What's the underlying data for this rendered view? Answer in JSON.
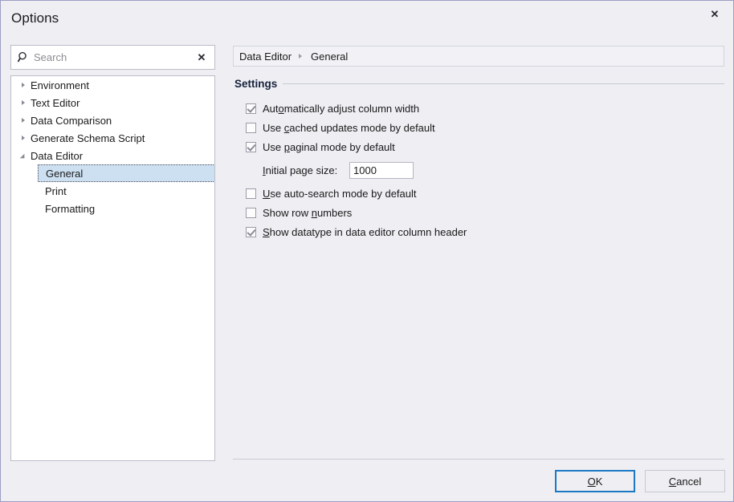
{
  "window": {
    "title": "Options",
    "close_icon": "close-icon",
    "close_label": "✕"
  },
  "search": {
    "placeholder": "Search",
    "value": "",
    "icon": "search-icon",
    "clear_label": "✕"
  },
  "tree": {
    "items": [
      {
        "label": "Environment",
        "level": 0,
        "state": "collapsed",
        "selected": false
      },
      {
        "label": "Text Editor",
        "level": 0,
        "state": "collapsed",
        "selected": false
      },
      {
        "label": "Data Comparison",
        "level": 0,
        "state": "collapsed",
        "selected": false
      },
      {
        "label": "Generate Schema Script",
        "level": 0,
        "state": "collapsed",
        "selected": false
      },
      {
        "label": "Data Editor",
        "level": 0,
        "state": "expanded",
        "selected": false
      },
      {
        "label": "General",
        "level": 1,
        "state": "leaf",
        "selected": true
      },
      {
        "label": "Print",
        "level": 1,
        "state": "leaf",
        "selected": false
      },
      {
        "label": "Formatting",
        "level": 1,
        "state": "leaf",
        "selected": false
      }
    ]
  },
  "breadcrumb": {
    "parent": "Data Editor",
    "current": "General"
  },
  "settings_group": {
    "title": "Settings"
  },
  "checkboxes": [
    {
      "label_before": "Aut",
      "mnemonic": "o",
      "label_after": "matically adjust column width",
      "checked": true
    },
    {
      "label_before": "Use ",
      "mnemonic": "c",
      "label_after": "ached updates mode by default",
      "checked": false
    },
    {
      "label_before": "Use ",
      "mnemonic": "p",
      "label_after": "aginal mode by default",
      "checked": true
    },
    {
      "label_before": "",
      "mnemonic": "U",
      "label_after": "se auto-search mode by default",
      "checked": false
    },
    {
      "label_before": "Show row ",
      "mnemonic": "n",
      "label_after": "umbers",
      "checked": false
    },
    {
      "label_before": "",
      "mnemonic": "S",
      "label_after": "how datatype in data editor column header",
      "checked": true
    }
  ],
  "page_size_field": {
    "label_mnemonic": "I",
    "label_rest": "nitial page size:",
    "value": "1000"
  },
  "footer": {
    "ok_mnemonic": "O",
    "ok_rest": "K",
    "cancel_mnemonic": "C",
    "cancel_rest": "ancel"
  },
  "colors": {
    "dialog_bg": "#eeeef3",
    "dialog_border": "#9d9ec4",
    "panel_bg": "#ffffff",
    "selection_bg": "#cde0f2",
    "focus_border": "#1b79c4",
    "group_title": "#16213c"
  }
}
